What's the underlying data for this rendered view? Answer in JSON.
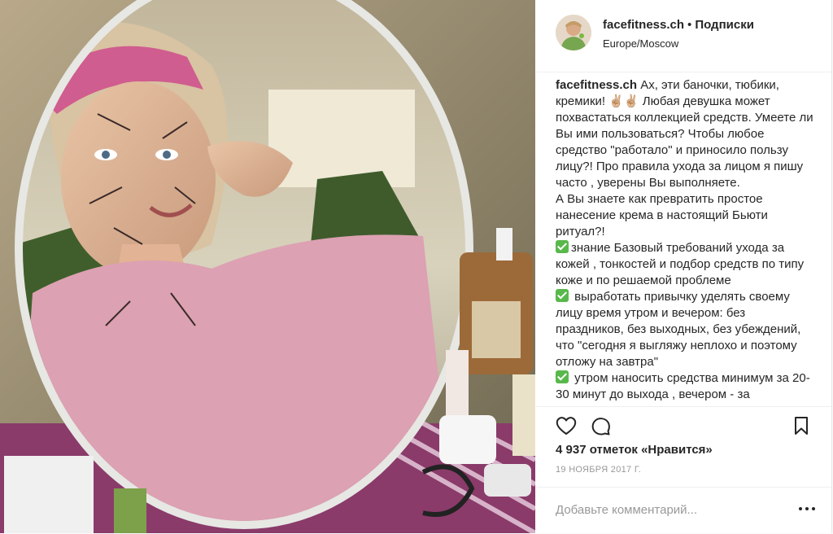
{
  "post": {
    "username": "facefitness.ch",
    "separator": "•",
    "follow_label": "Подписки",
    "location": "Europe/Moscow",
    "caption": {
      "username": "facefitness.ch",
      "intro": "Ах, эти баночки, тюбики, кремики!",
      "intro_emoji": "✌🏼✌🏼",
      "line_2": "Любая девушка может похвастаться коллекцией средств. Умеете ли Вы ими пользоваться? Чтобы любое средство \"работало\" и приносило пользу лицу?! Про правила ухода за лицом я пишу часто , уверены Вы выполняете.",
      "line_3": "А Вы знаете как превратить простое нанесение крема в настоящий Бьюти ритуал?!",
      "item_1": "знание Базовый требований ухода за кожей , тонкостей и подбор средств по типу коже и по решаемой проблеме",
      "item_2": "выработать привычку уделять своему лицу время утром и вечером: без праздников, без выходных, без убеждений, что \"сегодня я выгляжу неплохо и поэтому отложу на завтра\"",
      "item_3": "утром наносить средства минимум за 20- 30 минут до выхода , вечером - за"
    },
    "likes_text": "4 937 отметок «Нравится»",
    "date": "19 НОЯБРЯ 2017 Г.",
    "comment_placeholder": "Добавьте комментарий...",
    "icons": [
      "heart-icon",
      "comment-icon",
      "bookmark-icon",
      "more-options-icon",
      "check-mark-icon"
    ],
    "colors": {
      "check": "#59b84b",
      "meta": "#999999",
      "border": "#efefef"
    }
  }
}
